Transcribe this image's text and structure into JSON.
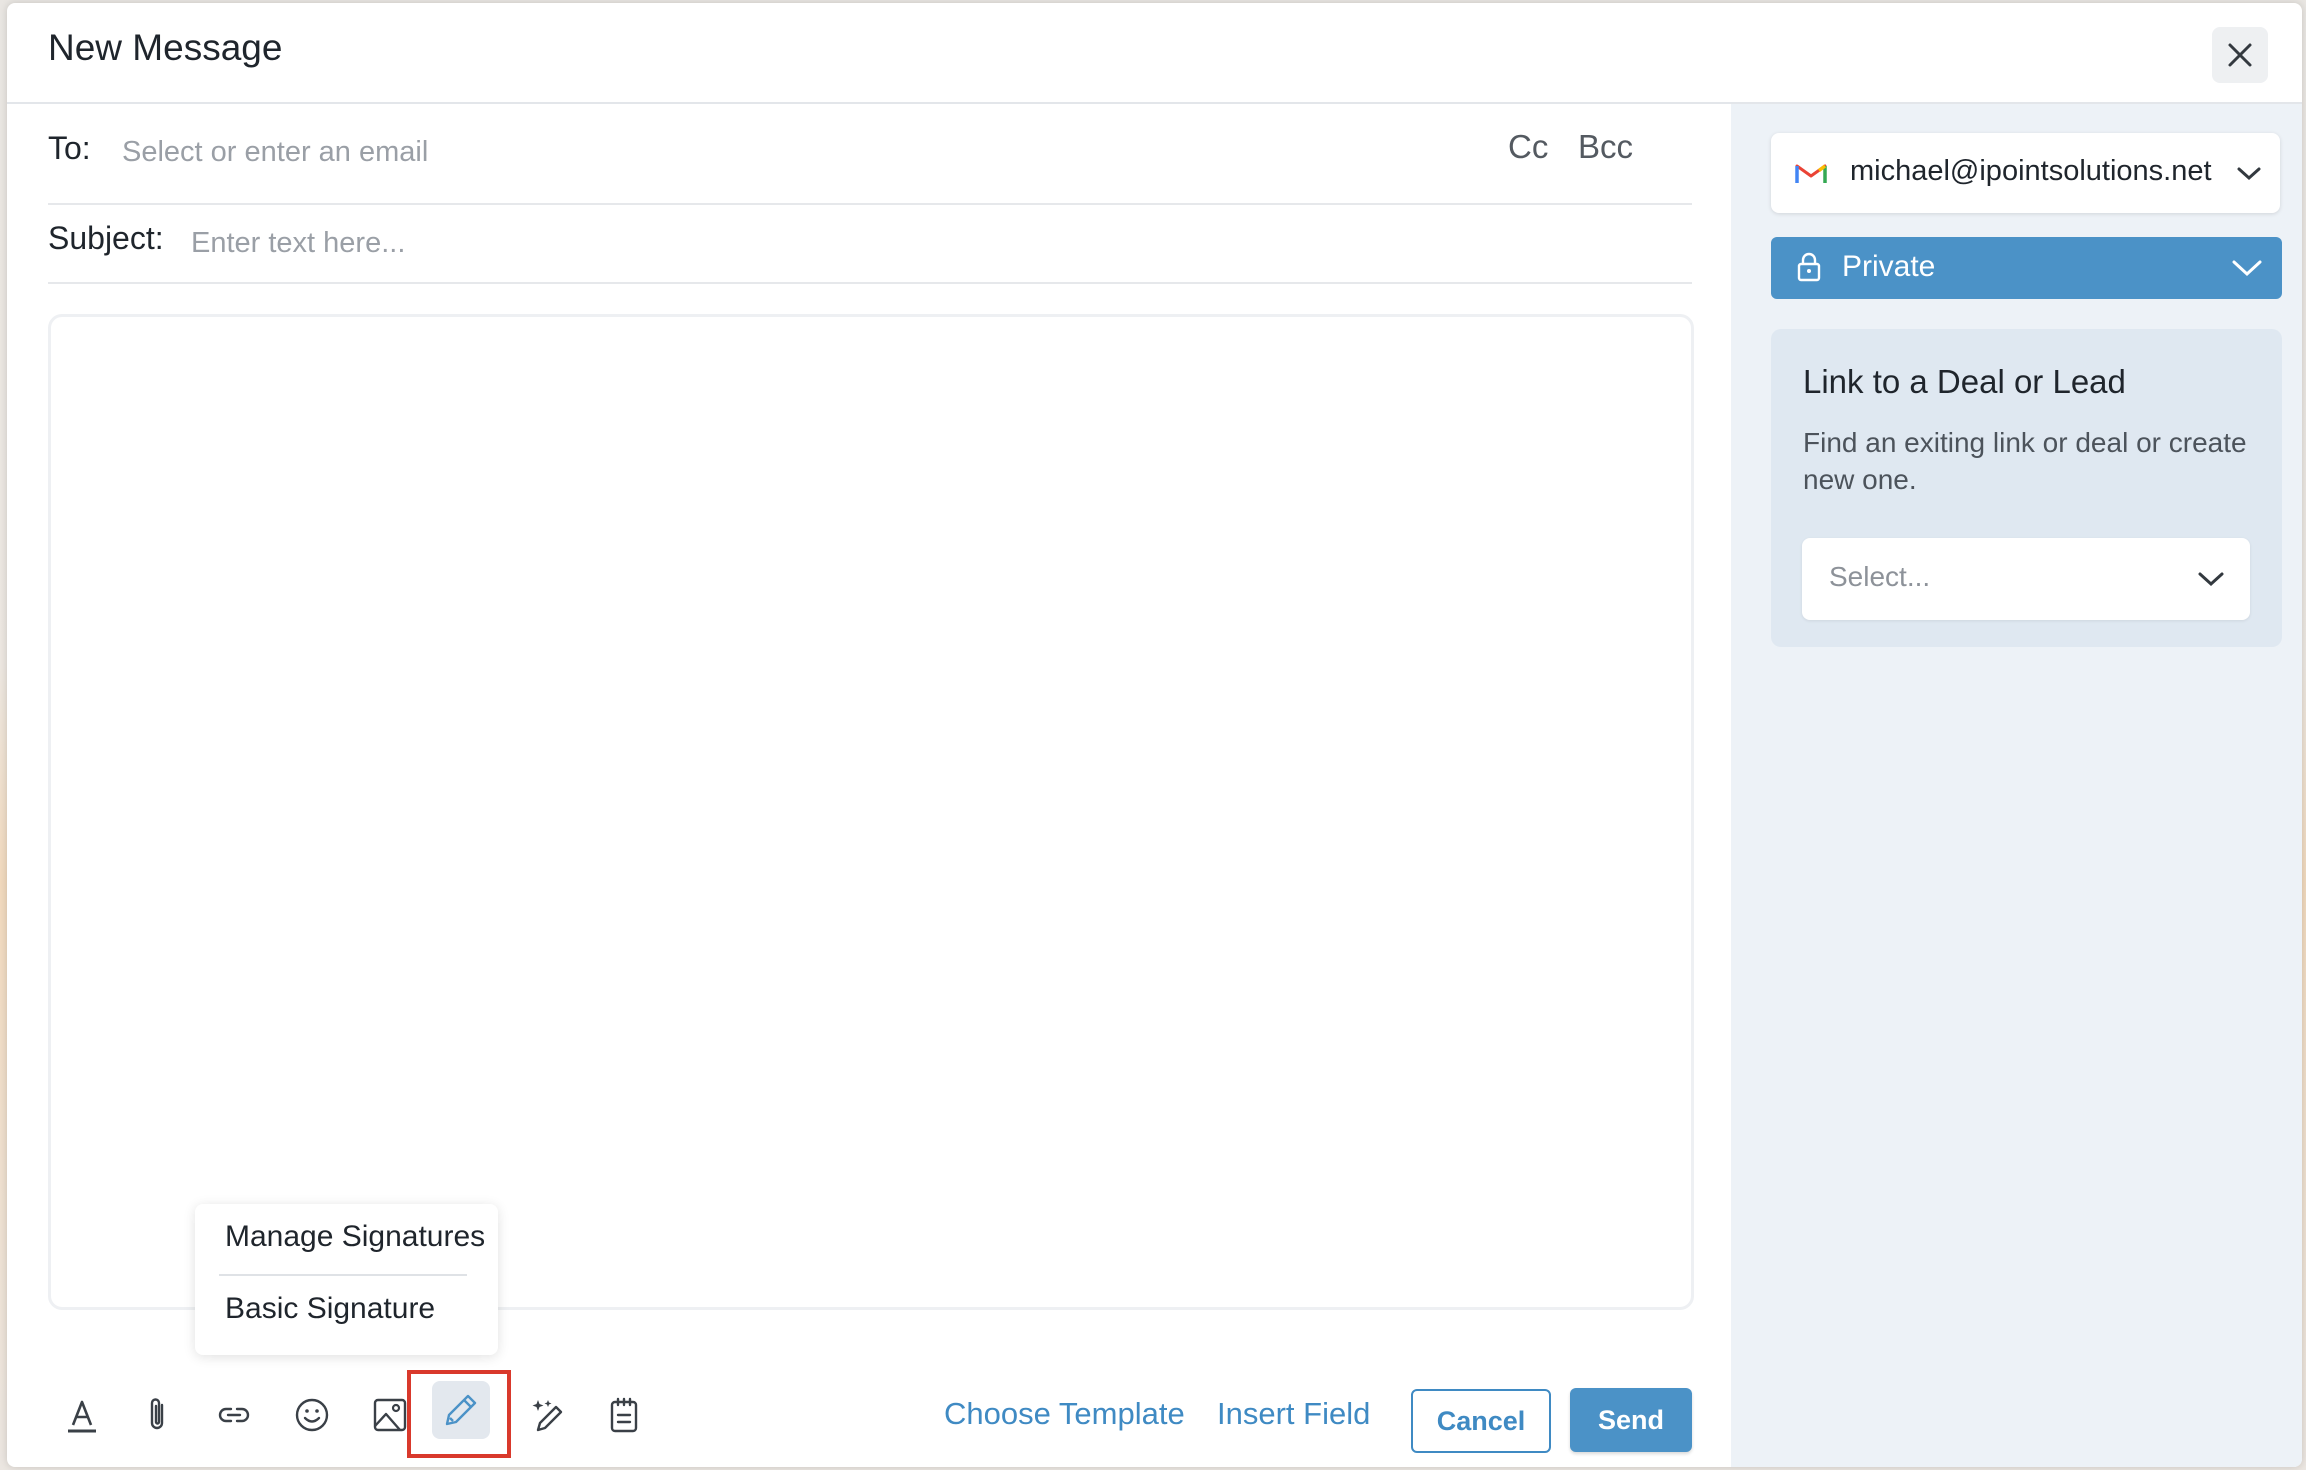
{
  "header": {
    "title": "New Message"
  },
  "compose": {
    "to_label": "To:",
    "to_placeholder": "Select or enter an email",
    "cc_label": "Cc",
    "bcc_label": "Bcc",
    "subject_label": "Subject:",
    "subject_placeholder": "Enter text here..."
  },
  "toolbar": {
    "icons": [
      "text-format-icon",
      "attachment-icon",
      "link-icon",
      "emoji-icon",
      "image-icon",
      "signature-icon",
      "ai-writer-icon",
      "notes-icon"
    ],
    "choose_template": "Choose Template",
    "insert_field": "Insert Field",
    "cancel": "Cancel",
    "send": "Send"
  },
  "signature_menu": {
    "items": [
      "Manage Signatures",
      "Basic Signature"
    ]
  },
  "sidebar": {
    "account_email": "michael@ipointsolutions.net",
    "visibility": "Private",
    "link_title": "Link to a Deal or Lead",
    "link_desc": "Find an exiting link or deal or create new one.",
    "link_select_placeholder": "Select..."
  },
  "colors": {
    "accent": "#4b92c7",
    "link": "#3f8ac3",
    "highlight": "#d9392c"
  }
}
